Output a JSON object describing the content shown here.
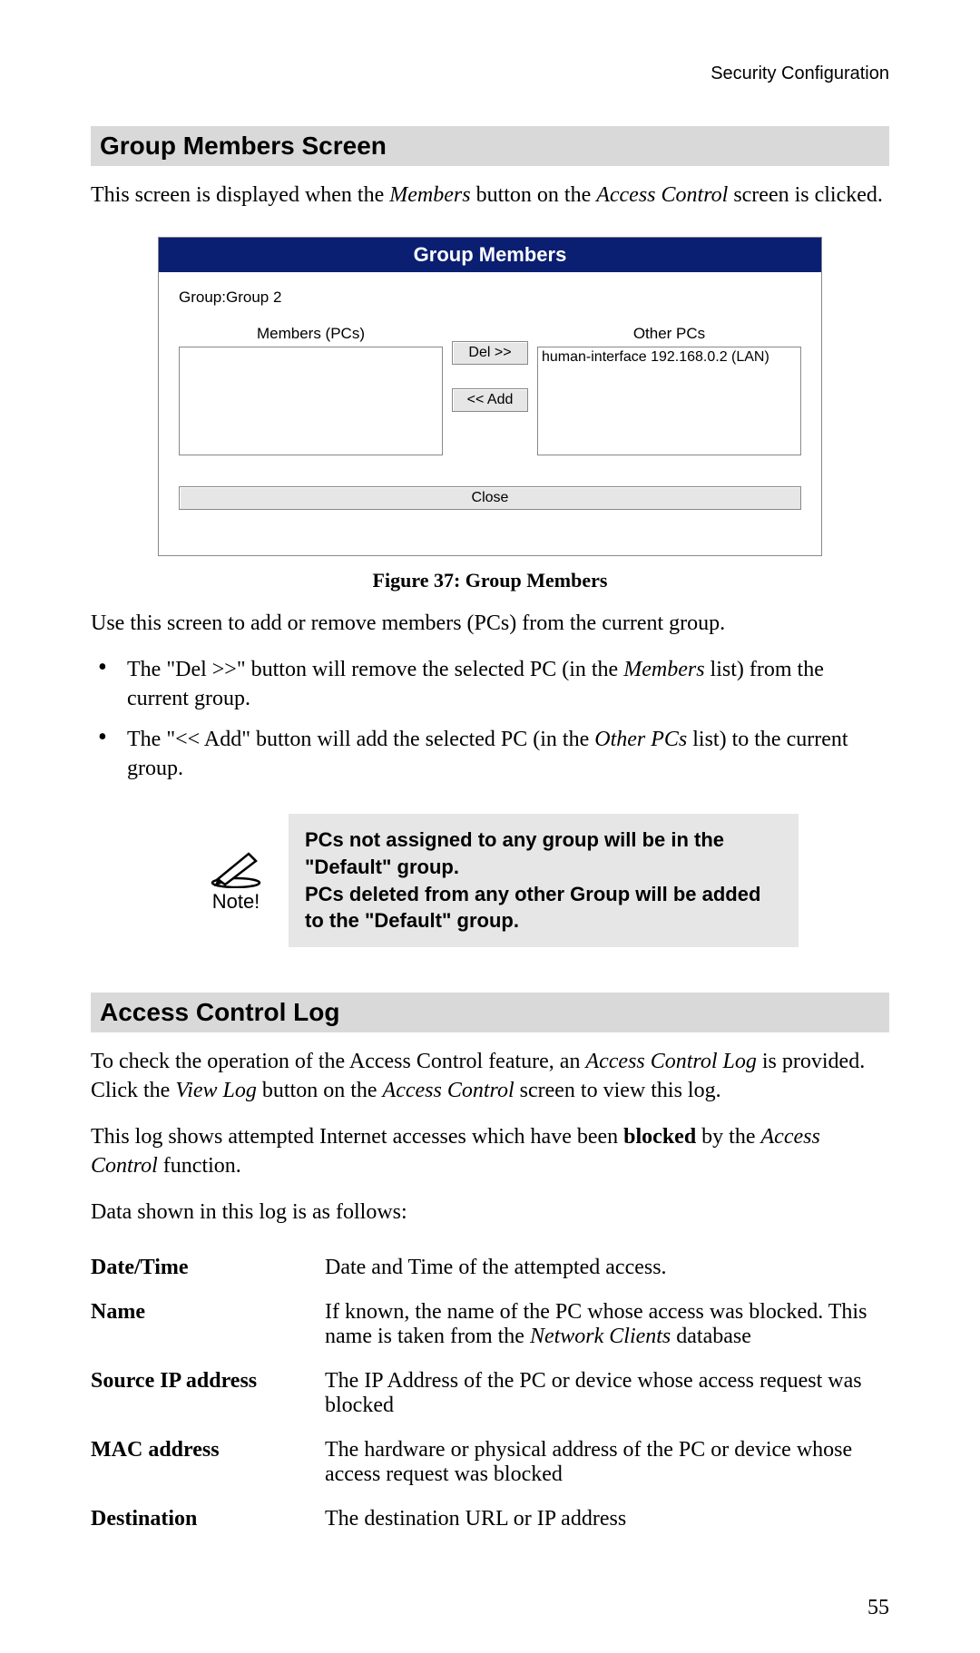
{
  "header": {
    "topLabel": "Security Configuration"
  },
  "section1": {
    "title": "Group Members Screen",
    "intro_pre": "This screen is displayed when the ",
    "intro_em1": "Members",
    "intro_mid": " button on the ",
    "intro_em2": "Access Control",
    "intro_post": " screen is clicked."
  },
  "dialog": {
    "title": "Group Members",
    "group_prefix": "Group:",
    "group_name": "Group 2",
    "members_header": "Members (PCs)",
    "others_header": "Other PCs",
    "other_entry": "human-interface 192.168.0.2 (LAN)",
    "btn_del": "Del >>",
    "btn_add": "<< Add",
    "btn_close": "Close"
  },
  "figure_caption": "Figure 37: Group Members",
  "after_figure": "Use this screen to add or remove members (PCs) from the current group.",
  "bullets": {
    "b1_pre": "The \"Del >>\" button will remove the selected PC (in the ",
    "b1_em": "Members",
    "b1_post": " list) from the current group.",
    "b2_pre": "The \"<< Add\" button will add the selected PC (in the ",
    "b2_em": "Other PCs",
    "b2_post": " list) to the current group."
  },
  "note": {
    "icon_label": "Note!",
    "line1": "PCs not assigned to any group will be in the \"Default\" group.",
    "line2": "PCs deleted from any other Group will be added to the \"Default\" group."
  },
  "section2": {
    "title": "Access Control Log",
    "p1_pre": "To check the operation of the Access Control feature, an ",
    "p1_em1": "Access Control Log",
    "p1_mid": " is provided. Click the ",
    "p1_em2": "View Log",
    "p1_mid2": " button on the ",
    "p1_em3": "Access Control",
    "p1_post": " screen to view this log.",
    "p2_pre": "This log shows attempted Internet accesses which have been ",
    "p2_b": "blocked",
    "p2_mid": " by the ",
    "p2_em": "Access Control",
    "p2_post": " function.",
    "p3": "Data shown in this log is as follows:"
  },
  "defs": {
    "r1_term": "Date/Time",
    "r1_val": "Date and Time of the attempted access.",
    "r2_term": "Name",
    "r2_pre": "If known, the name of the PC whose access was blocked. This name is taken from the ",
    "r2_em": "Network Clients",
    "r2_post": " database",
    "r3_term": "Source IP address",
    "r3_val": "The IP Address of the PC or device whose access request was blocked",
    "r4_term": "MAC address",
    "r4_val": "The hardware or physical address of the PC or device whose access request was blocked",
    "r5_term": "Destination",
    "r5_val": "The destination URL or IP address"
  },
  "page_number": "55"
}
